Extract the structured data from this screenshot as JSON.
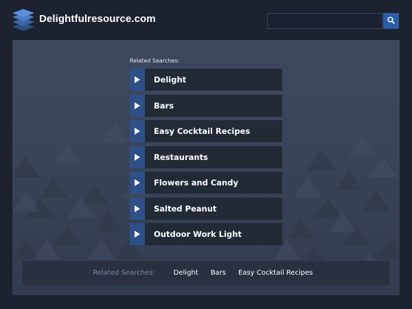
{
  "header": {
    "site_name": "Delightfulresource.com",
    "logo_icon": "stacked-layers-icon",
    "search": {
      "placeholder": "",
      "value": "",
      "button_icon": "search-icon"
    }
  },
  "main": {
    "related_title": "Related Searches:",
    "links": [
      {
        "label": "Delight",
        "icon": "play-arrow-icon"
      },
      {
        "label": "Bars",
        "icon": "play-arrow-icon"
      },
      {
        "label": "Easy Cocktail Recipes",
        "icon": "play-arrow-icon"
      },
      {
        "label": "Restaurants",
        "icon": "play-arrow-icon"
      },
      {
        "label": "Flowers and Candy",
        "icon": "play-arrow-icon"
      },
      {
        "label": "Salted Peanut",
        "icon": "play-arrow-icon"
      },
      {
        "label": "Outdoor Work Light",
        "icon": "play-arrow-icon"
      }
    ]
  },
  "footer": {
    "label": "Related Searches:",
    "links": [
      "Delight",
      "Bars",
      "Easy Cocktail Recipes"
    ]
  },
  "colors": {
    "page_bg": "#1c2230",
    "panel_bg": "#3a4459",
    "link_bg": "#222a36",
    "accent": "#2e5088",
    "search_button": "#2d5ea4",
    "footer_label": "#7b88a8"
  }
}
